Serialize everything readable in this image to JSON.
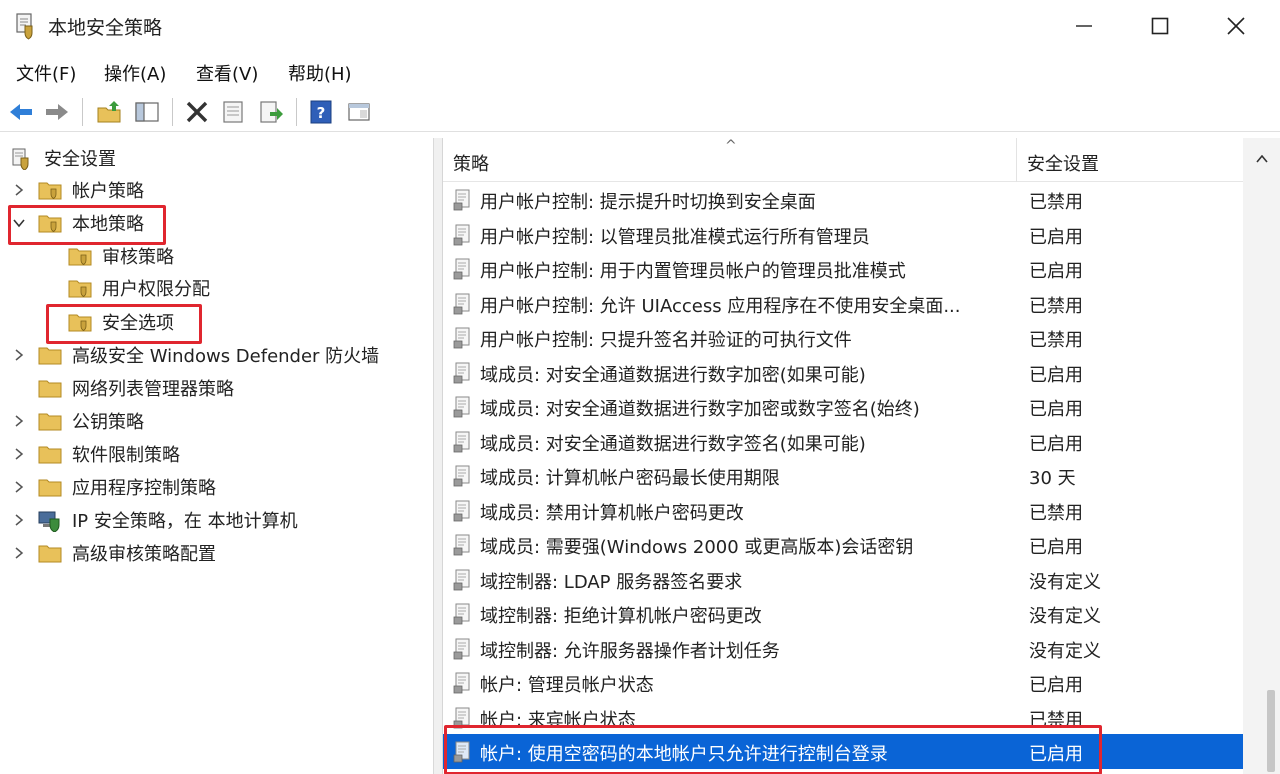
{
  "window": {
    "title": "本地安全策略",
    "minimize_icon": "minimize-icon",
    "maximize_icon": "maximize-icon",
    "close_icon": "close-icon"
  },
  "menu": [
    {
      "label": "文件(F)"
    },
    {
      "label": "操作(A)"
    },
    {
      "label": "查看(V)"
    },
    {
      "label": "帮助(H)"
    }
  ],
  "toolbar": {
    "buttons": [
      "back-arrow-icon",
      "forward-arrow-icon",
      "up-folder-icon",
      "show-hide-tree-icon",
      "delete-icon",
      "properties-icon",
      "export-list-icon",
      "help-icon",
      "console-icon"
    ]
  },
  "tree": {
    "root": "安全设置",
    "items": [
      {
        "label": "帐户策略"
      },
      {
        "label": "本地策略"
      },
      {
        "label": "审核策略"
      },
      {
        "label": "用户权限分配"
      },
      {
        "label": "安全选项"
      },
      {
        "label": "高级安全 Windows Defender 防火墙"
      },
      {
        "label": "网络列表管理器策略"
      },
      {
        "label": "公钥策略"
      },
      {
        "label": "软件限制策略"
      },
      {
        "label": "应用程序控制策略"
      },
      {
        "label": "IP 安全策略，在 本地计算机"
      },
      {
        "label": "高级审核策略配置"
      }
    ]
  },
  "list": {
    "headers": {
      "policy": "策略",
      "setting": "安全设置"
    },
    "rows": [
      {
        "policy": "用户帐户控制: 提示提升时切换到安全桌面",
        "setting": "已禁用"
      },
      {
        "policy": "用户帐户控制: 以管理员批准模式运行所有管理员",
        "setting": "已启用"
      },
      {
        "policy": "用户帐户控制: 用于内置管理员帐户的管理员批准模式",
        "setting": "已启用"
      },
      {
        "policy": "用户帐户控制: 允许 UIAccess 应用程序在不使用安全桌面...",
        "setting": "已禁用"
      },
      {
        "policy": "用户帐户控制: 只提升签名并验证的可执行文件",
        "setting": "已禁用"
      },
      {
        "policy": "域成员: 对安全通道数据进行数字加密(如果可能)",
        "setting": "已启用"
      },
      {
        "policy": "域成员: 对安全通道数据进行数字加密或数字签名(始终)",
        "setting": "已启用"
      },
      {
        "policy": "域成员: 对安全通道数据进行数字签名(如果可能)",
        "setting": "已启用"
      },
      {
        "policy": "域成员: 计算机帐户密码最长使用期限",
        "setting": "30 天"
      },
      {
        "policy": "域成员: 禁用计算机帐户密码更改",
        "setting": "已禁用"
      },
      {
        "policy": "域成员: 需要强(Windows 2000 或更高版本)会话密钥",
        "setting": "已启用"
      },
      {
        "policy": "域控制器: LDAP 服务器签名要求",
        "setting": "没有定义"
      },
      {
        "policy": "域控制器: 拒绝计算机帐户密码更改",
        "setting": "没有定义"
      },
      {
        "policy": "域控制器: 允许服务器操作者计划任务",
        "setting": "没有定义"
      },
      {
        "policy": "帐户: 管理员帐户状态",
        "setting": "已启用"
      },
      {
        "policy": "帐户: 来宾帐户状态",
        "setting": "已禁用"
      },
      {
        "policy": "帐户: 使用空密码的本地帐户只允许进行控制台登录",
        "setting": "已启用"
      }
    ]
  },
  "colors": {
    "selection": "#0a64d6",
    "highlight_box": "#e0262f",
    "folder": "#e8c15a"
  }
}
